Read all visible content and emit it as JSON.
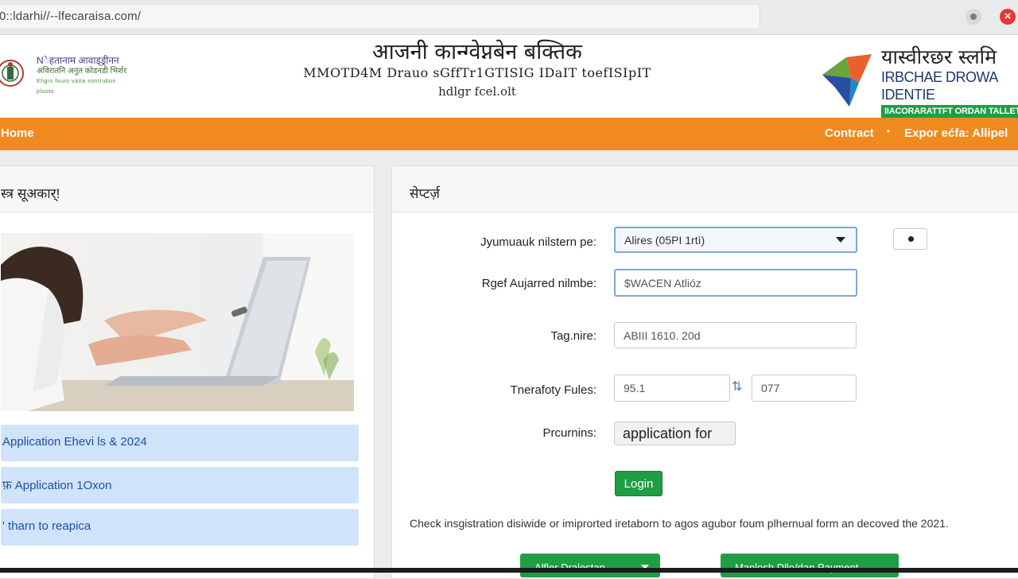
{
  "browser": {
    "url": "0::ldarhi//--lfecaraisa.com/"
  },
  "header": {
    "left_logo": {
      "line1": "Nेहतानाम आवाड्ड्रीनन",
      "line2": "अविरातनि अनुत कोडनडी भिर्शर",
      "line3": "Ehgrs fouro vatta sontrubon pluoto"
    },
    "title_hindi": "आजनी कान्ग्वेप्नबेन बक्तिक",
    "title_english": "MMOTD4M Drauo sGffTr1GTISIG IDaIT toefISIpIT",
    "title_sub": "hdlgr fcel.olt",
    "right_logo": {
      "hindi": "यास्वीरछर स्लमि",
      "english": "IRBCHAE DROWA IDENTIE",
      "tag": "IIACORARATTFT ORDAN TALLET"
    }
  },
  "nav": {
    "home": "Home",
    "contract": "Contract",
    "separator": "•",
    "export": "Expor ećfa: Allipel"
  },
  "left_panel": {
    "heading": "स्त्र सूअकार्!",
    "links": [
      "Application  Ehevi ls & 2024",
      "फ़ Application  1Oxon",
      "' tharn to reapica"
    ]
  },
  "right_panel": {
    "heading": "सेप्टर्ज़",
    "form": {
      "select_label": "Jyumuauk nilstern pe:",
      "select_value": "Alires (05PI 1rtì)",
      "reference_label": "Rgef Aujarred nilmbe:",
      "reference_value": "$WACEN Atlióz",
      "tag_label": "Tag.nire:",
      "tag_value": "ABIII  1610. 20d",
      "fules_label": "Tnerafoty Fules:",
      "fules_value_1": "95.1",
      "fules_value_2": "077",
      "returns_label": "Prcurnins:",
      "returns_chip": "application for",
      "login_button": "Login"
    },
    "notice": "Check insgistration disiwide or imiprorted iretaborn to agos agubor foum plhernual form an decoved the 2021.",
    "buttons": [
      "Alfler  Dralestan",
      "Manlosh Dllo/dan Payment"
    ]
  },
  "colors": {
    "nav_orange": "#ef8a1f",
    "green": "#1f9e45",
    "link_bg": "#cfe3fb",
    "link_text": "#1e4fa5"
  }
}
